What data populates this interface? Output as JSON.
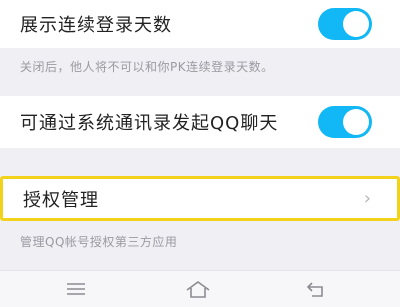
{
  "settings": {
    "show_login_days": {
      "label": "展示连续登录天数",
      "enabled": true
    },
    "show_login_days_hint": "关闭后，他人将不可以和你PK连续登录天数。",
    "contacts_chat": {
      "label": "可通过系统通讯录发起QQ聊天",
      "enabled": true
    },
    "auth_management": {
      "label": "授权管理",
      "chevron": "›"
    },
    "auth_management_hint": "管理QQ帐号授权第三方应用"
  },
  "navbar": {
    "menu_icon": "menu-icon",
    "home_icon": "home-icon",
    "back_icon": "back-icon"
  },
  "colors": {
    "toggle_on": "#12b7f5",
    "highlight_border": "#f3d21c",
    "background": "#efeff4"
  }
}
